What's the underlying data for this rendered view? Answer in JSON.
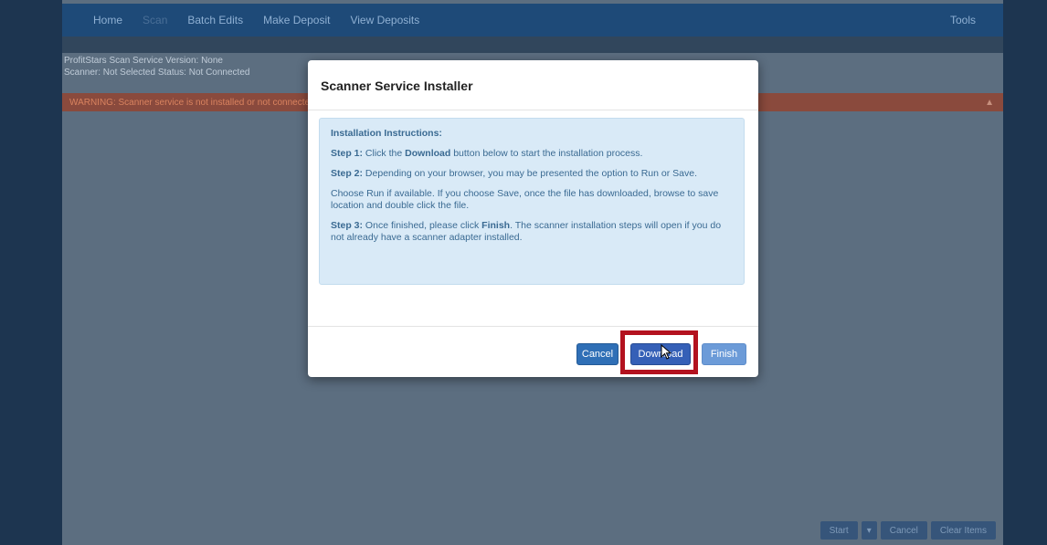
{
  "nav": {
    "items": [
      "Home",
      "Scan",
      "Batch Edits",
      "Make Deposit",
      "View Deposits"
    ],
    "tools": "Tools"
  },
  "status": {
    "service_version": "ProfitStars Scan Service Version: None",
    "scanner_line": "Scanner: Not Selected     Status: Not Connected"
  },
  "error": {
    "text": "WARNING: Scanner service is not installed or not connected."
  },
  "bottom_buttons": [
    "Start",
    "▾",
    "Cancel",
    "Clear Items"
  ],
  "modal": {
    "title": "Scanner Service Installer",
    "instructions": {
      "title": "Installation Instructions:",
      "step1_label": "Step 1:",
      "step1_pre": " Click the ",
      "step1_bold": "Download",
      "step1_post": " button below to start the installation process.",
      "step2_label": "Step 2:",
      "step2_text": " Depending on your browser, you may be presented the option to Run or Save.",
      "choose_text": "Choose Run if available. If you choose Save, once the file has downloaded, browse to save location and double click the file.",
      "step3_label": "Step 3:",
      "step3_pre": " Once finished, please click ",
      "step3_bold": "Finish",
      "step3_post": ". The scanner installation steps will open if you do not already have a scanner adapter installed."
    },
    "buttons": {
      "cancel": "Cancel",
      "download": "Download",
      "finish": "Finish"
    }
  },
  "colors": {
    "highlight": "#b3121f",
    "primary_button": "#3560b7",
    "instructions_bg": "#d9eaf7"
  }
}
